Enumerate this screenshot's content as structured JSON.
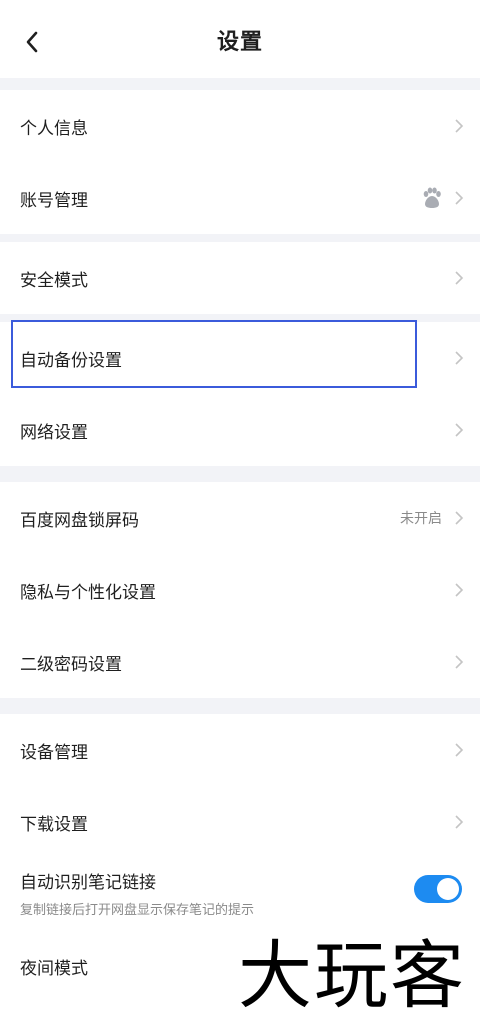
{
  "header": {
    "title": "设置"
  },
  "sections": [
    {
      "items": [
        {
          "label": "个人信息"
        },
        {
          "label": "账号管理"
        }
      ]
    },
    {
      "items": [
        {
          "label": "安全模式"
        }
      ]
    },
    {
      "items": [
        {
          "label": "自动备份设置"
        },
        {
          "label": "网络设置"
        }
      ]
    },
    {
      "items": [
        {
          "label": "百度网盘锁屏码",
          "value": "未开启"
        },
        {
          "label": "隐私与个性化设置"
        },
        {
          "label": "二级密码设置"
        }
      ]
    },
    {
      "items": [
        {
          "label": "设备管理"
        },
        {
          "label": "下载设置"
        },
        {
          "label": "自动识别笔记链接",
          "sublabel": "复制链接后打开网盘显示保存笔记的提示",
          "toggle_on": true
        },
        {
          "label": "夜间模式"
        }
      ]
    }
  ],
  "watermark": "大玩客",
  "colors": {
    "accent": "#1d8bf1",
    "highlight": "#3b5bdb",
    "divider": "#f2f3f7"
  }
}
